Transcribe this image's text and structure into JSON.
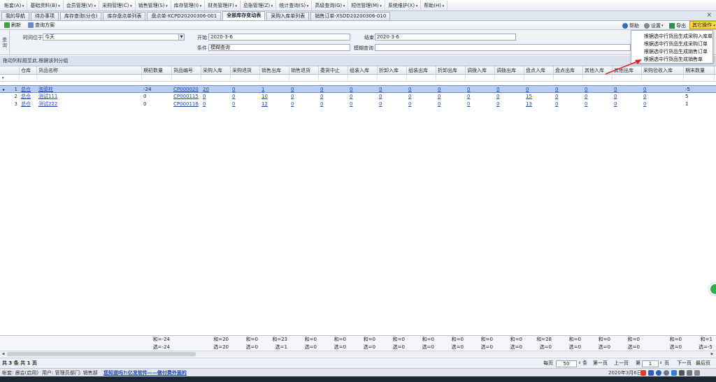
{
  "menubar": {
    "items": [
      "帐套(A)",
      "基础资料(B)",
      "会员管理(V)",
      "采购管理(C)",
      "销售管理(S)",
      "库存管理(I)",
      "财务管理(F)",
      "总账管理(Z)",
      "统计查询(S)",
      "高级查询(G)",
      "短信管理(M)",
      "系统维护(X)",
      "帮助(H)"
    ]
  },
  "tabs": {
    "items": [
      "我的导航",
      "待办事项",
      "库存查询(分仓)",
      "库存盘点单列表",
      "盘点单-KCPD20200306-001",
      "全部库存变动表",
      "采购入库单列表",
      "销售订单-XSDD20200306-010"
    ],
    "active_index": 5,
    "close_glyph": "×"
  },
  "toolbar": {
    "refresh": "刷新",
    "query_scheme": "查询方案",
    "help": "帮助",
    "settings": "设置",
    "export": "导出",
    "more": "其它操作"
  },
  "dropdown": {
    "items": [
      "根据选中行货品生成采购入库单",
      "根据选中行货品生成采购订单",
      "根据选中行货品生成销售订单",
      "根据选中行货品生成销售单"
    ]
  },
  "query": {
    "side_label_1": "查",
    "side_label_2": "询",
    "time_label": "时间位于",
    "time_value": "今天",
    "start_label": "开始",
    "start_value": "2020-3-6",
    "end_label": "结束",
    "end_value": "2020-3-6",
    "condition_label": "条件",
    "condition_value": "模糊查询",
    "fuzzy_label": "模糊查询",
    "fuzzy_value": ""
  },
  "group_hint": "拖动列标题至此,根据该列分组",
  "grid": {
    "columns": [
      "仓库",
      "货品名称",
      "期初数量",
      "货品编号",
      "采购入库",
      "采购退货",
      "销售出库",
      "销售退货",
      "委货中止",
      "组装入库",
      "折卸入库",
      "组装出库",
      "折卸出库",
      "调拨入库",
      "调拨出库",
      "盘点入库",
      "盘点出库",
      "其他入库",
      "其他出库",
      "采购验收入库",
      "期末数量"
    ],
    "rows": [
      {
        "rn": "1",
        "warehouse": "总仓",
        "name": "泡菜柱",
        "opening": "-24",
        "code": "CP000020",
        "v": [
          "20",
          "0",
          "1",
          "0",
          "0",
          "0",
          "0",
          "0",
          "0",
          "0",
          "0",
          "0",
          "0",
          "0",
          "0",
          "0"
        ],
        "closing": "-5"
      },
      {
        "rn": "2",
        "warehouse": "总仓",
        "name": "测试111",
        "opening": "0",
        "code": "CP000115",
        "v": [
          "0",
          "0",
          "10",
          "0",
          "0",
          "0",
          "0",
          "0",
          "0",
          "0",
          "0",
          "15",
          "0",
          "0",
          "0",
          "0"
        ],
        "closing": "5"
      },
      {
        "rn": "3",
        "warehouse": "总仓",
        "name": "测试222",
        "opening": "0",
        "code": "CP000116",
        "v": [
          "0",
          "0",
          "12",
          "0",
          "0",
          "0",
          "0",
          "0",
          "0",
          "0",
          "0",
          "13",
          "0",
          "0",
          "0",
          "0"
        ],
        "closing": "1"
      }
    ],
    "row_indicator": "▸",
    "filter_indicator": "▾"
  },
  "summary": {
    "total_row": [
      "和=-24",
      "",
      "和=20",
      "和=0",
      "和=23",
      "和=0",
      "和=0",
      "和=0",
      "和=0",
      "和=0",
      "和=0",
      "和=0",
      "和=0",
      "和=28",
      "和=0",
      "和=0",
      "和=0",
      "和=0",
      "和=1"
    ],
    "selected_row": [
      "选=-24",
      "",
      "选=20",
      "选=0",
      "选=1",
      "选=0",
      "选=0",
      "选=0",
      "选=0",
      "选=0",
      "选=0",
      "选=0",
      "选=0",
      "选=0",
      "选=0",
      "选=0",
      "选=0",
      "选=0",
      "选=-5"
    ]
  },
  "pager": {
    "info": "共 3 条 共 1 页",
    "per_page_label": "每页",
    "per_page_value": "50",
    "per_page_unit": "条",
    "first": "第一页",
    "prev": "上一页",
    "page_label": "第",
    "page_value": "1",
    "page_unit": "页",
    "next": "下一页",
    "last": "最后页"
  },
  "statusbar": {
    "account": "帐套: 晨会(启用)",
    "user": "用户: 管理员",
    "dept": "部门: 销售部",
    "promo": "您知道吗?:亿发软件——做付费外面的",
    "date": "2020年3月6日"
  },
  "colors": {
    "accent": "#ffd84a",
    "link": "#1a45b5",
    "selected_row": "#b9cdf0",
    "arrow": "#e02020"
  }
}
